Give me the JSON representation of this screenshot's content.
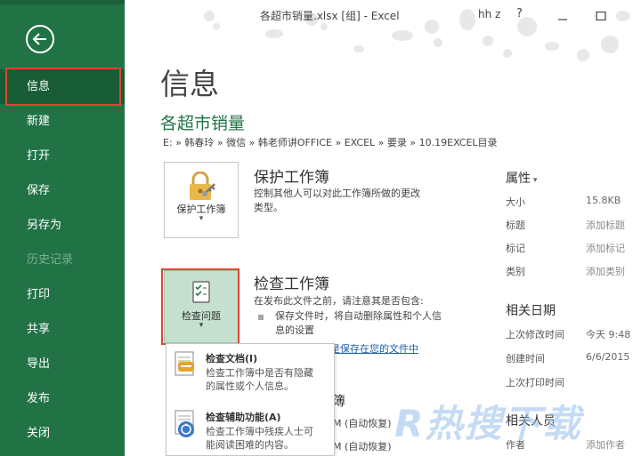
{
  "window": {
    "title": "各超市销量.xlsx  [组]  -  Excel",
    "user": "hh z",
    "help": "?"
  },
  "nav": {
    "items": [
      {
        "label": "信息",
        "state": "active"
      },
      {
        "label": "新建",
        "state": "normal"
      },
      {
        "label": "打开",
        "state": "normal"
      },
      {
        "label": "保存",
        "state": "normal"
      },
      {
        "label": "另存为",
        "state": "normal"
      },
      {
        "label": "历史记录",
        "state": "disabled"
      },
      {
        "label": "打印",
        "state": "normal"
      },
      {
        "label": "共享",
        "state": "normal"
      },
      {
        "label": "导出",
        "state": "normal"
      },
      {
        "label": "发布",
        "state": "normal"
      },
      {
        "label": "关闭",
        "state": "normal"
      }
    ]
  },
  "main": {
    "page_title": "信息",
    "doc_name": "各超市销量",
    "path": "E: » 韩春玲 » 微信 » 韩老师讲OFFICE » EXCEL » 要录 » 10.19EXCEL目录",
    "protect": {
      "tile_label": "保护工作簿",
      "heading": "保护工作簿",
      "description_line1": "控制其他人可以对此工作簿所做的更改",
      "description_line2": "类型。"
    },
    "inspect": {
      "tile_label": "检查问题",
      "heading": "检查工作簿",
      "description": "在发布此文件之前，请注意其是否包含:",
      "bullet": "保存文件时，将自动删除属性和个人信息的设置",
      "link": "是保存在您的文件中"
    },
    "menu": {
      "items": [
        {
          "title": "检查文档(I)",
          "desc": "检查工作簿中是否有隐藏的属性或个人信息。",
          "icon": "inspect-document-icon"
        },
        {
          "title": "检查辅助功能(A)",
          "desc": "检查工作簿中残疾人士可能阅读困难的内容。",
          "icon": "accessibility-check-icon"
        }
      ]
    },
    "versions": {
      "heading_fragment": "簿",
      "row1": "M (自动恢复)",
      "row2": "M (自动恢复)"
    }
  },
  "properties": {
    "heading": "属性",
    "rows": [
      {
        "key": "大小",
        "value": "15.8KB",
        "muted": false
      },
      {
        "key": "标题",
        "value": "添加标题",
        "muted": true
      },
      {
        "key": "标记",
        "value": "添加标记",
        "muted": true
      },
      {
        "key": "类别",
        "value": "添加类别",
        "muted": true
      }
    ],
    "dates_heading": "相关日期",
    "dates": [
      {
        "key": "上次修改时间",
        "value": "今天 9:48"
      },
      {
        "key": "创建时间",
        "value": "6/6/2015"
      },
      {
        "key": "上次打印时间",
        "value": ""
      }
    ],
    "people_heading": "相关人员",
    "people": [
      {
        "key": "作者",
        "value": "添加作者"
      }
    ]
  },
  "watermark": "R热搜下载",
  "colors": {
    "nav_bg": "#217346",
    "accent_green": "#217346",
    "highlight_red": "#e0452f",
    "link_blue": "#1f5fa5"
  }
}
